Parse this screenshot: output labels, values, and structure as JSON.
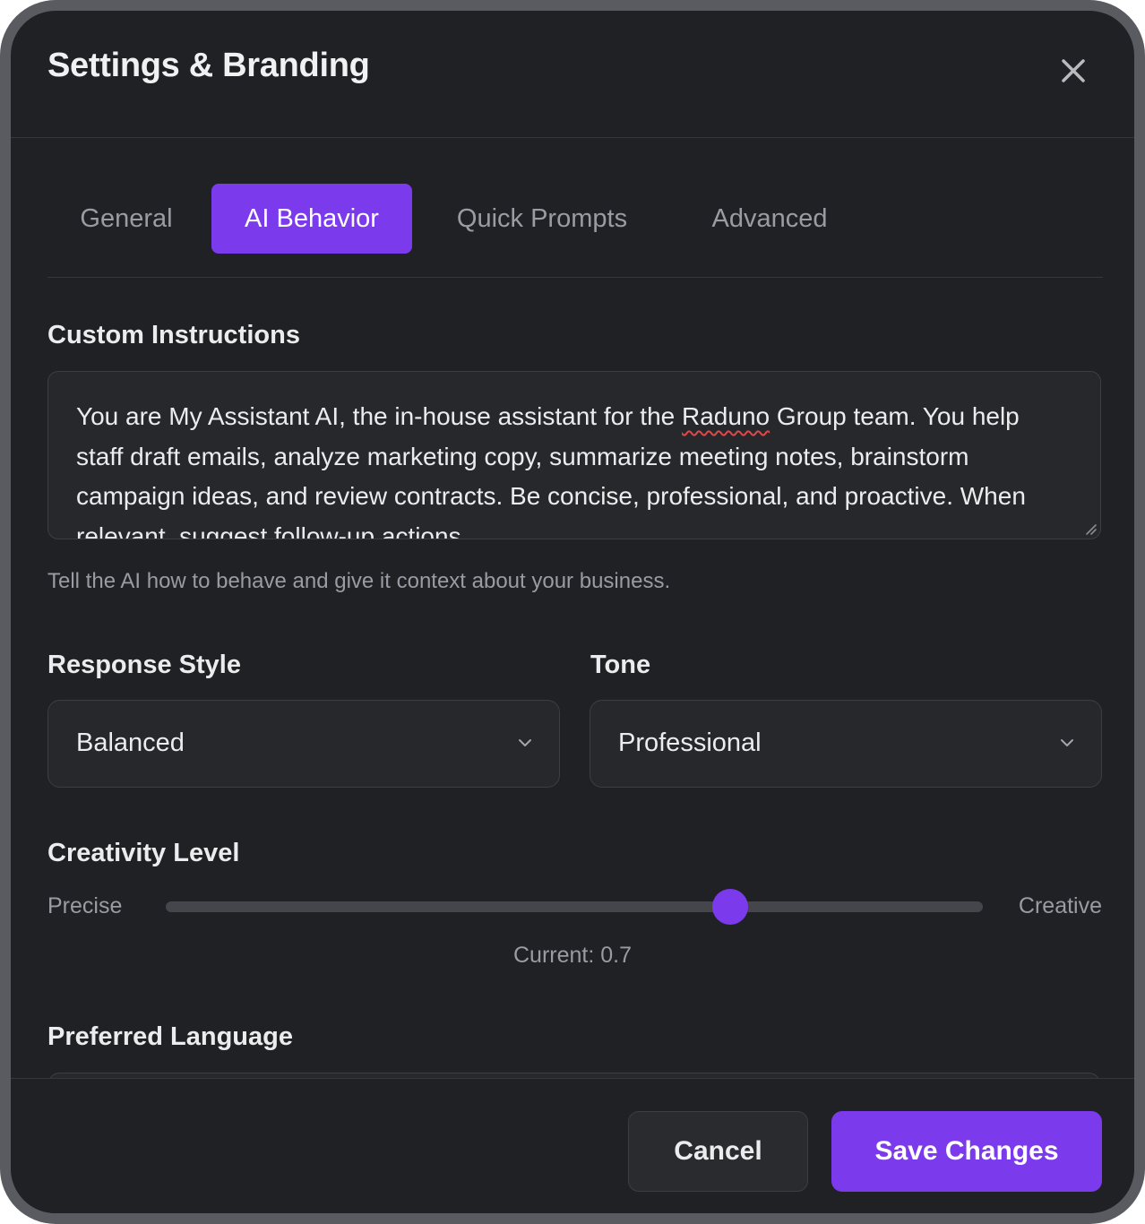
{
  "modal": {
    "title": "Settings & Branding",
    "close_icon": "close-icon"
  },
  "tabs": [
    {
      "label": "General",
      "active": false
    },
    {
      "label": "AI Behavior",
      "active": true
    },
    {
      "label": "Quick Prompts",
      "active": false
    },
    {
      "label": "Advanced",
      "active": false
    }
  ],
  "custom_instructions": {
    "label": "Custom Instructions",
    "value_before": "You are My Assistant AI, the in-house assistant for the ",
    "value_flagged": "Raduno",
    "value_after": " Group team. You help staff draft emails, analyze marketing copy, summarize meeting notes, brainstorm campaign ideas, and review contracts. Be concise, professional, and proactive. When relevant, suggest follow-up actions.",
    "hint": "Tell the AI how to behave and give it context about your business."
  },
  "response_style": {
    "label": "Response Style",
    "selected": "Balanced",
    "icon": "chevron-down-icon"
  },
  "tone": {
    "label": "Tone",
    "selected": "Professional",
    "icon": "chevron-down-icon"
  },
  "creativity": {
    "label": "Creativity Level",
    "min_label": "Precise",
    "max_label": "Creative",
    "value": 0.7,
    "current_text": "Current: 0.7"
  },
  "preferred_language": {
    "label": "Preferred Language"
  },
  "footer": {
    "cancel_label": "Cancel",
    "save_label": "Save Changes"
  },
  "colors": {
    "accent": "#7c3aed",
    "surface": "#202124",
    "field": "#27282b"
  }
}
